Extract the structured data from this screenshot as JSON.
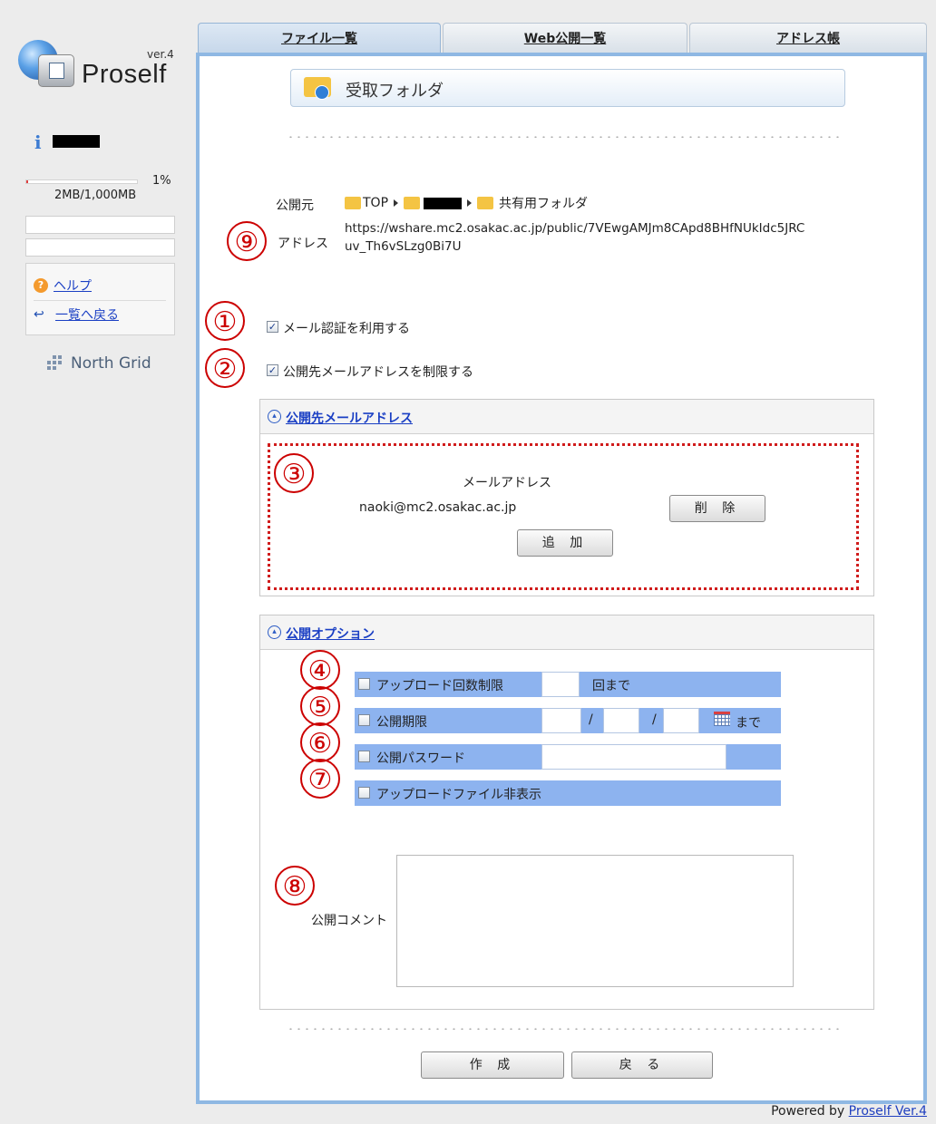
{
  "app": {
    "brand": "Proself",
    "version": "ver.4",
    "footer_prefix": "Powered by ",
    "footer_link": "Proself Ver.4"
  },
  "tabs": [
    {
      "label": "ファイル一覧",
      "active": true
    },
    {
      "label": "Web公開一覧",
      "active": false
    },
    {
      "label": "アドレス帳",
      "active": false
    }
  ],
  "sidebar": {
    "quota_percent": "1%",
    "quota_text": "2MB/1,000MB",
    "quota_fraction": 0.01,
    "links": [
      {
        "label": "ヘルプ",
        "icon": "help-icon"
      },
      {
        "label": "一覧へ戻る",
        "icon": "back-arrow-icon"
      }
    ],
    "partner": "North Grid"
  },
  "folder": {
    "title": "受取フォルダ"
  },
  "publish": {
    "source_label": "公開元",
    "breadcrumb": [
      "TOP",
      "共有用フォルダ"
    ],
    "address_label": "アドレス",
    "url_line1": "https://wshare.mc2.osakac.ac.jp/public/7VEwgAMJm8CApd8BHfNUkIdc5JRC",
    "url_line2": "uv_Th6vSLzg0Bi7U"
  },
  "options": {
    "mail_auth": {
      "label": "メール認証を利用する",
      "checked": true
    },
    "restrict_address": {
      "label": "公開先メールアドレスを制限する",
      "checked": true
    }
  },
  "mail_section": {
    "header": "公開先メールアドレス",
    "column_header": "メールアドレス",
    "email": "naoki@mc2.osakac.ac.jp",
    "delete_button": "削 除",
    "add_button": "追 加"
  },
  "publish_options": {
    "header": "公開オプション",
    "upload_limit_label": "アップロード回数制限",
    "upload_limit_suffix": "回まで",
    "expiry_label": "公開期限",
    "date_sep": "/",
    "expiry_suffix": "まで",
    "password_label": "公開パスワード",
    "hide_files_label": "アップロードファイル非表示",
    "comment_label": "公開コメント"
  },
  "annotations": [
    "①",
    "②",
    "③",
    "④",
    "⑤",
    "⑥",
    "⑦",
    "⑧",
    "⑨"
  ],
  "buttons": {
    "create": "作 成",
    "back": "戻 る"
  },
  "colors": {
    "accent": "#8fb8e3",
    "option_row": "#8db3ef",
    "annotation": "#cc0000"
  }
}
